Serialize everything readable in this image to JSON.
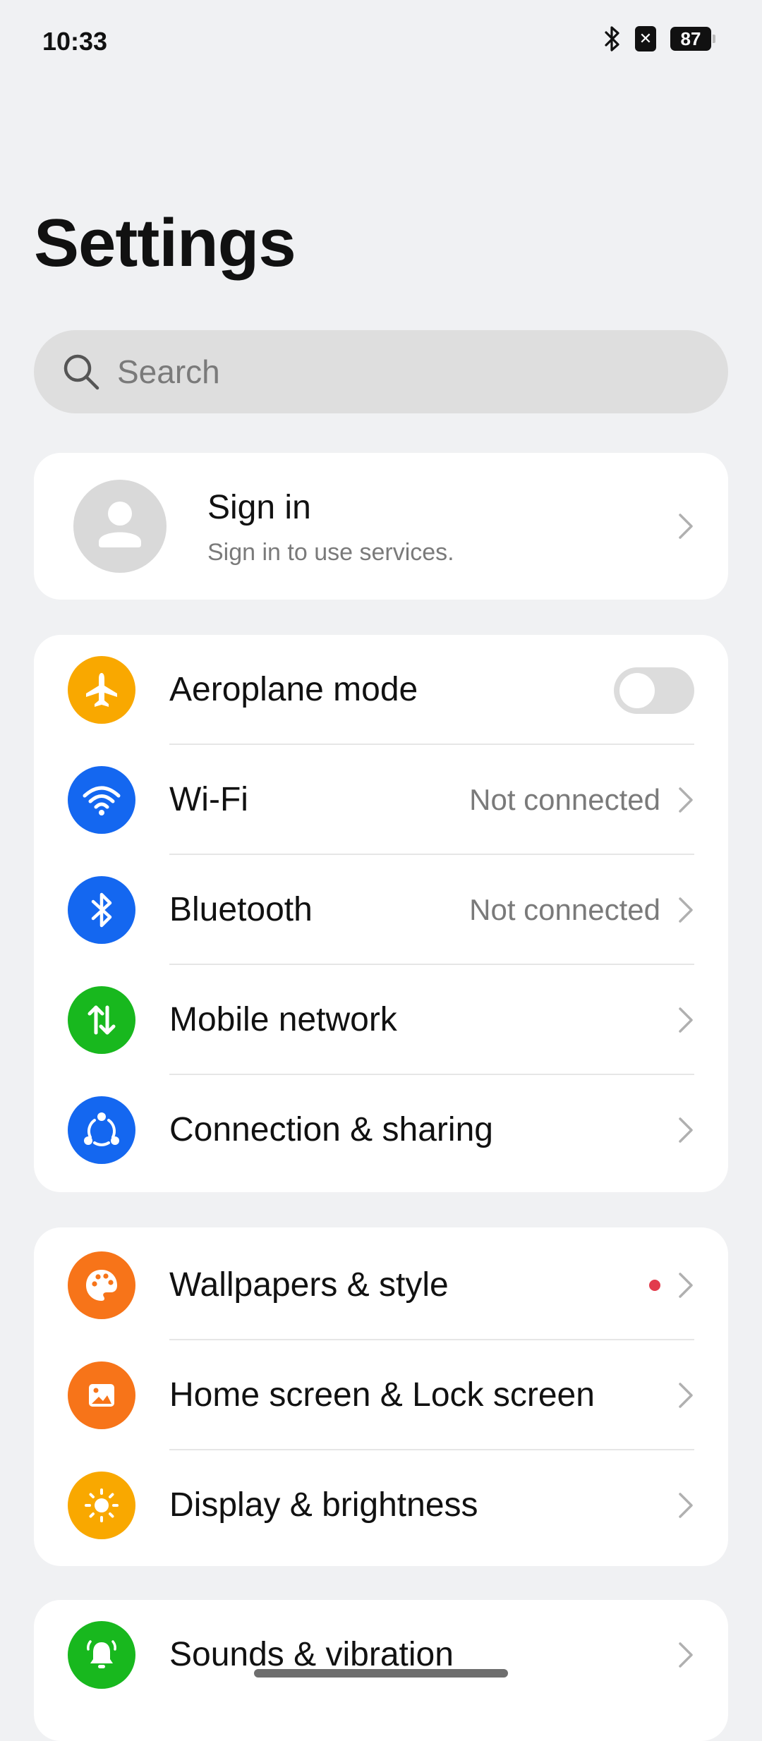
{
  "status_bar": {
    "time": "10:33",
    "icons": [
      "bluetooth-icon",
      "sim-icon",
      "battery-icon"
    ],
    "sim_symbol": "✕",
    "battery_level": "87"
  },
  "header": {
    "title": "Settings"
  },
  "search": {
    "placeholder": "Search",
    "value": ""
  },
  "account": {
    "title": "Sign in",
    "subtitle": "Sign in to use services."
  },
  "network_group": {
    "items": [
      {
        "label": "Aeroplane mode",
        "icon": "airplane-icon",
        "color": "#f9a800",
        "control": "toggle",
        "enabled": false
      },
      {
        "label": "Wi-Fi",
        "value": "Not connected",
        "icon": "wifi-icon",
        "color": "#1467f0"
      },
      {
        "label": "Bluetooth",
        "value": "Not connected",
        "icon": "bluetooth-icon",
        "color": "#1467f0"
      },
      {
        "label": "Mobile network",
        "icon": "mobile-data-icon",
        "color": "#18b81e"
      },
      {
        "label": "Connection & sharing",
        "icon": "share-icon",
        "color": "#1467f0"
      }
    ]
  },
  "style_group": {
    "items": [
      {
        "label": "Wallpapers & style",
        "icon": "palette-icon",
        "color": "#f77419",
        "badge": "red-dot"
      },
      {
        "label": "Home screen & Lock screen",
        "icon": "home-screen-icon",
        "color": "#f77419"
      },
      {
        "label": "Display & brightness",
        "icon": "brightness-icon",
        "color": "#f9a800"
      }
    ]
  },
  "sound_group": {
    "items": [
      {
        "label": "Sounds & vibration",
        "icon": "bell-icon",
        "color": "#18b81e"
      }
    ]
  }
}
